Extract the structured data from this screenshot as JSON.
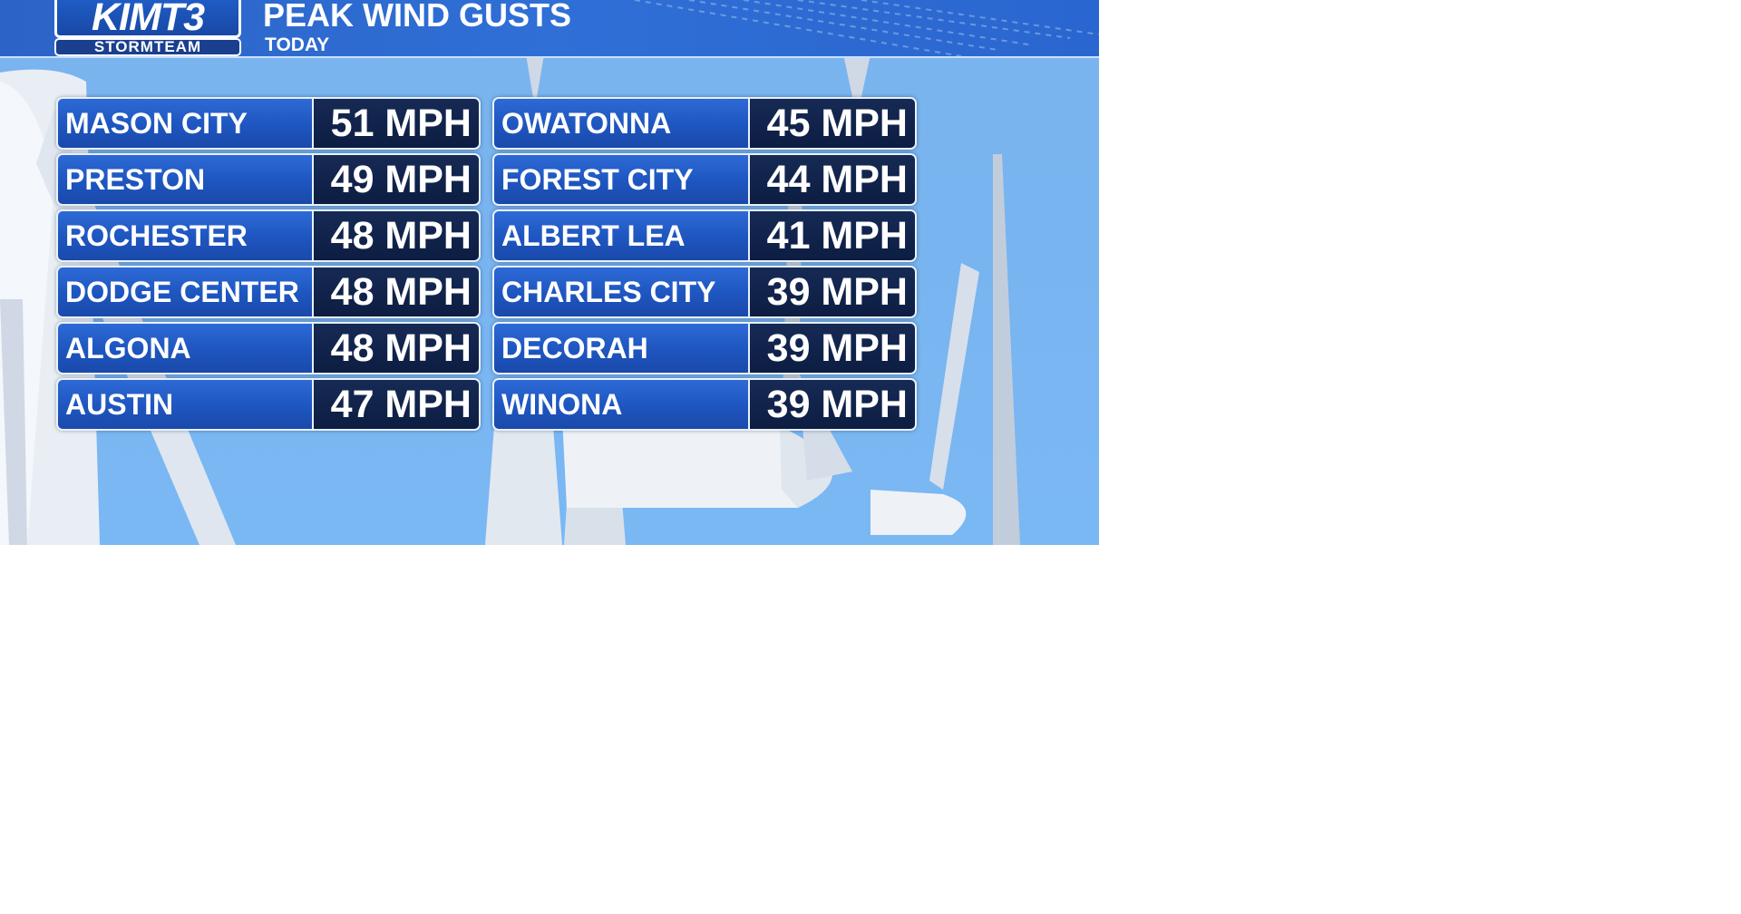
{
  "header": {
    "logo_text": "KIMT3",
    "logo_sub": "STORMTEAM",
    "title": "PEAK WIND GUSTS",
    "subtitle": "TODAY"
  },
  "left_column": [
    {
      "city": "MASON CITY",
      "speed": "51 MPH"
    },
    {
      "city": "PRESTON",
      "speed": "49 MPH"
    },
    {
      "city": "ROCHESTER",
      "speed": "48 MPH"
    },
    {
      "city": "DODGE CENTER",
      "speed": "48 MPH"
    },
    {
      "city": "ALGONA",
      "speed": "48 MPH"
    },
    {
      "city": "AUSTIN",
      "speed": "47 MPH"
    }
  ],
  "right_column": [
    {
      "city": "OWATONNA",
      "speed": "45 MPH"
    },
    {
      "city": "FOREST CITY",
      "speed": "44 MPH"
    },
    {
      "city": "ALBERT LEA",
      "speed": "41 MPH"
    },
    {
      "city": "CHARLES CITY",
      "speed": "39 MPH"
    },
    {
      "city": "DECORAH",
      "speed": "39 MPH"
    },
    {
      "city": "WINONA",
      "speed": "39 MPH"
    }
  ],
  "colors": {
    "sky": "#78b4f0",
    "city_cell": "#1e55bf",
    "speed_cell": "#0d1d42",
    "header": "#2c63c6"
  }
}
